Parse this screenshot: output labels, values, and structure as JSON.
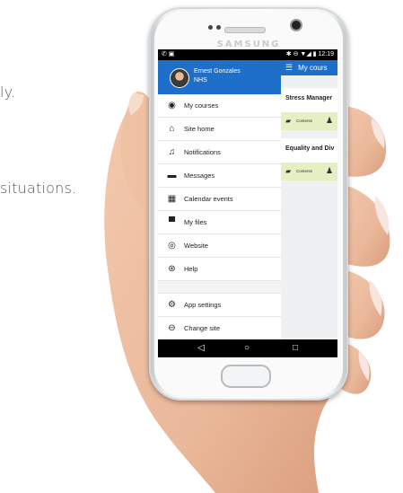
{
  "background": {
    "line1": "ly.",
    "line2": "situations."
  },
  "phone": {
    "brand": "SAMSUNG"
  },
  "statusbar": {
    "left": "✆ ▣",
    "time": "12:19",
    "icons": "✱ ⊖ ▼◢ ▮"
  },
  "drawer": {
    "user_name": "Ernest Gonzales",
    "user_org": "NHS",
    "items": [
      {
        "label": "My courses",
        "icon": "radio-icon"
      },
      {
        "label": "Site home",
        "icon": "home-icon"
      },
      {
        "label": "Notifications",
        "icon": "bell-icon"
      },
      {
        "label": "Messages",
        "icon": "chat-icon"
      },
      {
        "label": "Calendar events",
        "icon": "calendar-icon"
      },
      {
        "label": "My files",
        "icon": "folder-icon"
      },
      {
        "label": "Website",
        "icon": "globe-icon"
      },
      {
        "label": "Help",
        "icon": "lifebuoy-icon"
      }
    ],
    "bottom_items": [
      {
        "label": "App settings",
        "icon": "gear-icon"
      },
      {
        "label": "Change site",
        "icon": "exit-icon"
      }
    ]
  },
  "main": {
    "title": "My cours",
    "courses": [
      {
        "title": "Stress Manager",
        "contents": "Contents"
      },
      {
        "title": "Equality and Div",
        "contents": "Contents"
      }
    ]
  },
  "navbar": {
    "back": "◁",
    "home": "○",
    "recent": "□"
  },
  "colors": {
    "accent": "#1e6fc9",
    "card_footer": "#e4efc4"
  }
}
